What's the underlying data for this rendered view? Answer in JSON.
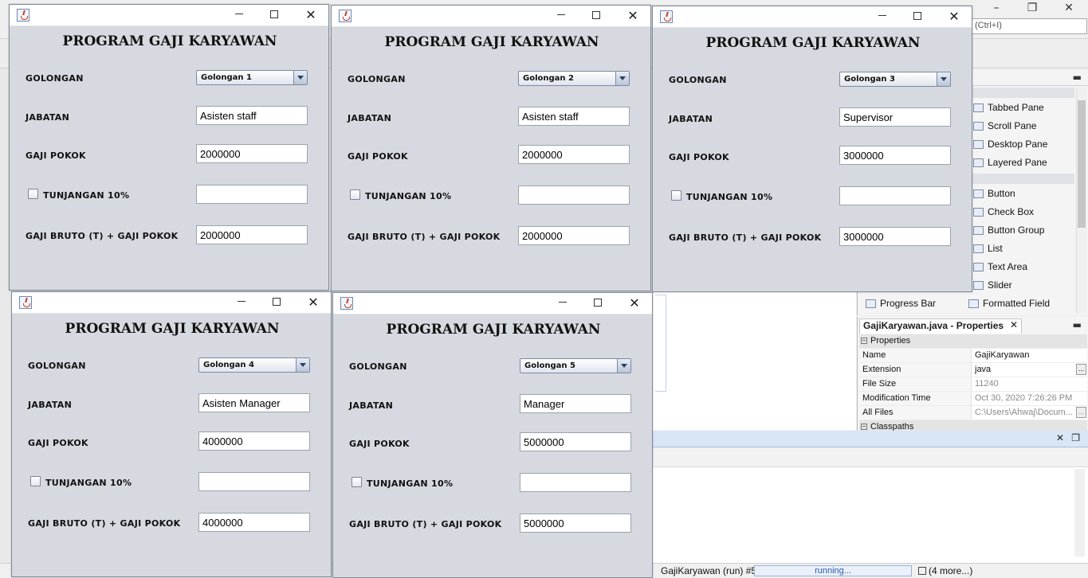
{
  "ide": {
    "search_hint": "(Ctrl+I)",
    "palette": {
      "items": [
        {
          "label": "Tabbed Pane",
          "icon": "tabbed-pane-icon"
        },
        {
          "label": "Scroll Pane",
          "icon": "scroll-pane-icon"
        },
        {
          "label": "Desktop Pane",
          "icon": "desktop-pane-icon"
        },
        {
          "label": "Layered Pane",
          "icon": "layered-pane-icon"
        },
        {
          "label": "Button",
          "icon": "button-icon"
        },
        {
          "label": "Check Box",
          "icon": "check-box-icon"
        },
        {
          "label": "Button Group",
          "icon": "button-group-icon"
        },
        {
          "label": "List",
          "icon": "list-icon"
        },
        {
          "label": "Text Area",
          "icon": "text-area-icon"
        },
        {
          "label": "Slider",
          "icon": "slider-icon"
        },
        {
          "label": "Progress Bar",
          "icon": "progress-bar-icon"
        },
        {
          "label": "Formatted Field",
          "icon": "formatted-field-icon"
        }
      ]
    },
    "properties": {
      "tab_title": "GajiKaryawan.java - Properties",
      "section_properties": "Properties",
      "rows": [
        {
          "key": "Name",
          "value": "GajiKaryawan"
        },
        {
          "key": "Extension",
          "value": "java"
        },
        {
          "key": "File Size",
          "value": "11240"
        },
        {
          "key": "Modification Time",
          "value": "Oct 30, 2020 7:26:26 PM"
        },
        {
          "key": "All Files",
          "value": "C:\\Users\\Ahwaj\\Docum..."
        }
      ],
      "section_classpaths": "Classpaths"
    },
    "status": {
      "run_label": "GajiKaryawan (run) #5",
      "progress_text": "running...",
      "more_label": "(4 more...)"
    }
  },
  "app": {
    "heading": "PROGRAM GAJI KARYAWAN",
    "labels": {
      "golongan": "GOLONGAN",
      "jabatan": "JABATAN",
      "gaji_pokok": "GAJI POKOK",
      "tunjangan": "TUNJANGAN 10%",
      "gaji_bruto": "GAJI BRUTO (T) + GAJI POKOK"
    },
    "windows": [
      {
        "golongan": "Golongan 1",
        "jabatan": "Asisten staff",
        "gaji_pokok": "2000000",
        "tunjangan": "",
        "gaji_bruto": "2000000"
      },
      {
        "golongan": "Golongan 2",
        "jabatan": "Asisten staff",
        "gaji_pokok": "2000000",
        "tunjangan": "",
        "gaji_bruto": "2000000"
      },
      {
        "golongan": "Golongan 3",
        "jabatan": "Supervisor",
        "gaji_pokok": "3000000",
        "tunjangan": "",
        "gaji_bruto": "3000000"
      },
      {
        "golongan": "Golongan 4",
        "jabatan": "Asisten Manager",
        "gaji_pokok": "4000000",
        "tunjangan": "",
        "gaji_bruto": "4000000"
      },
      {
        "golongan": "Golongan 5",
        "jabatan": "Manager",
        "gaji_pokok": "5000000",
        "tunjangan": "",
        "gaji_bruto": "5000000"
      }
    ]
  }
}
